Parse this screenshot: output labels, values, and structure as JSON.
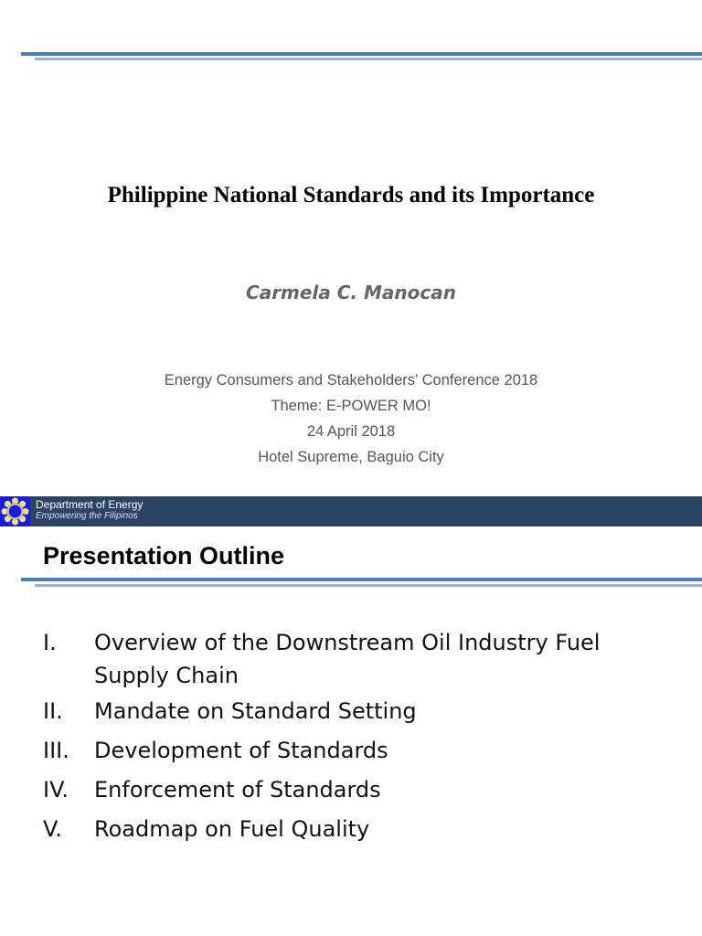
{
  "slide1": {
    "title": "Philippine National Standards and its Importance",
    "author": "Carmela C. Manocan",
    "conference": [
      "Energy Consumers and Stakeholders’ Conference 2018",
      "Theme: E-POWER MO!",
      "24 April 2018",
      "Hotel Supreme, Baguio City"
    ]
  },
  "banner": {
    "department": "Department of Energy",
    "tagline": "Empowering the Filipinos"
  },
  "slide2": {
    "heading": "Presentation Outline",
    "items": [
      {
        "num": "I.",
        "text": "Overview of the Downstream Oil Industry Fuel Supply Chain"
      },
      {
        "num": "II.",
        "text": "Mandate on Standard Setting"
      },
      {
        "num": "III.",
        "text": "Development of Standards"
      },
      {
        "num": "IV.",
        "text": "Enforcement of Standards"
      },
      {
        "num": "V.",
        "text": "Roadmap on Fuel Quality"
      }
    ]
  }
}
